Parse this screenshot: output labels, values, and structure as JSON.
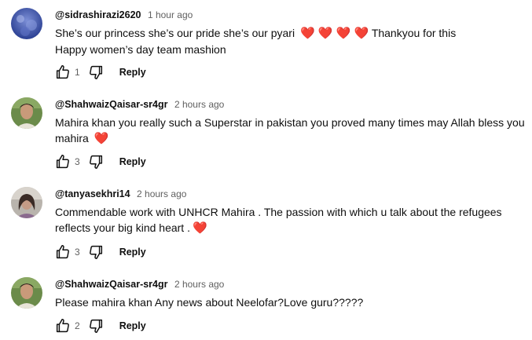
{
  "comments": [
    {
      "author": "@sidrashirazi2620",
      "time": "1 hour ago",
      "line1": "She’s our princess she’s our pride she’s our pyari",
      "line1_hearts": "❤️ ❤️ ❤️ ❤️",
      "line1_tail": "Thankyou for this",
      "line2": "Happy women’s day team mashion",
      "likes": "1",
      "reply_label": "Reply",
      "avatar": "blue-sky-avatar"
    },
    {
      "author": "@ShahwaizQaisar-sr4gr",
      "time": "2 hours ago",
      "line1": "Mahira khan you really such a Superstar in pakistan you proved many times may Allah bless you",
      "line2": "mahira",
      "line2_heart": "❤️",
      "likes": "3",
      "reply_label": "Reply",
      "avatar": "young-man-avatar"
    },
    {
      "author": "@tanyasekhri14",
      "time": "2 hours ago",
      "line1": "Commendable work with UNHCR Mahira . The passion with which u talk about the refugees",
      "line2": "reflects your big kind heart .",
      "line2_heart": "❤️",
      "likes": "3",
      "reply_label": "Reply",
      "avatar": "woman-avatar"
    },
    {
      "author": "@ShahwaizQaisar-sr4gr",
      "time": "2 hours ago",
      "line1": "Please mahira khan Any news about Neelofar?Love guru?????",
      "likes": "2",
      "reply_label": "Reply",
      "avatar": "young-man-avatar"
    }
  ],
  "colors": {
    "heart": "#e0245e",
    "secondary_text": "#606060",
    "primary_text": "#0f0f0f"
  },
  "icons": [
    "like-icon",
    "dislike-icon"
  ]
}
